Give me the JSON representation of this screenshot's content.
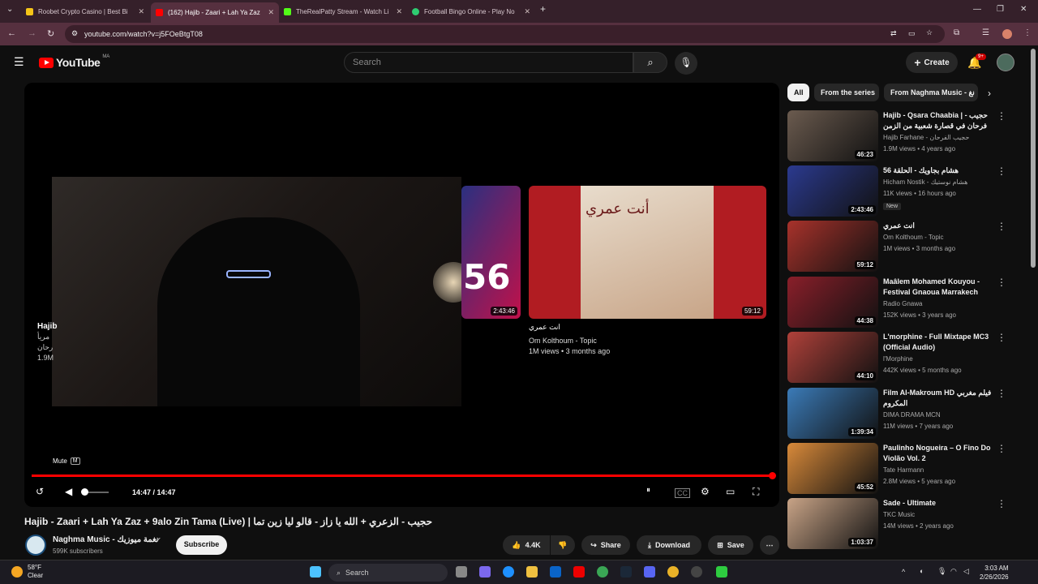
{
  "browser": {
    "tabs": [
      {
        "title": "Roobet Crypto Casino | Best Bi",
        "favicon_color": "#f5c518",
        "active": false
      },
      {
        "title": "(162) Hajib - Zaari + Lah Ya Zaz",
        "favicon_color": "#ff0000",
        "active": true
      },
      {
        "title": "TheRealPatty Stream - Watch Li",
        "favicon_color": "#53fc18",
        "active": false
      },
      {
        "title": "Football Bingo Online - Play No",
        "favicon_color": "#2ecc71",
        "active": false
      }
    ],
    "new_tab": "+",
    "url": "youtube.com/watch?v=j5FOeBtgT08"
  },
  "yt": {
    "logo_text": "YouTube",
    "country": "MA",
    "search_placeholder": "Search",
    "create_label": "Create",
    "notif_badge": "9+"
  },
  "player": {
    "mute_tooltip": "Mute",
    "mute_key": "M",
    "time": "14:47 / 14:47",
    "progress": 1.0,
    "left_card": {
      "title": "Hajib",
      "line2": "مريأ",
      "line3": "رحان",
      "views": "1.9M"
    },
    "endcard1": {
      "overlay": "56",
      "duration": "2:43:46"
    },
    "endcard2": {
      "poster_title": "أنت عمري",
      "duration": "59:12",
      "title": "انت عمري",
      "channel": "Om Kolthoum - Topic",
      "meta": "1M views • 3 months ago"
    }
  },
  "video": {
    "title": "Hajib - Zaari + Lah Ya Zaz + 9alo Zin Tama (Live) | حجيب - الزعري + الله يا زاز - قالو ليا زين تما",
    "channel": "Naghma Music - نغمة ميوزيك",
    "subscribers": "599K subscribers",
    "subscribe": "Subscribe",
    "likes": "4.4K",
    "share": "Share",
    "download": "Download",
    "save": "Save"
  },
  "sidebar": {
    "chips": [
      "All",
      "From the series",
      "From Naghma Music - نغ"
    ],
    "items": [
      {
        "title": "Hajib - Qsara Chaabia | حجيب - فرحان في قصارة شعبية من الزمن الجميل",
        "channel": "Hajib Farhane - حجيب الفرحان",
        "meta": "1.9M views • 4 years ago",
        "duration": "46:23",
        "color": "#6b5b4f",
        "badge": ""
      },
      {
        "title": "56 هشام بجاويك - الحلقة",
        "channel": "Hicham Nostik - هشام نوستيك",
        "meta": "11K views • 16 hours ago",
        "duration": "2:43:46",
        "color": "#2b3a8f",
        "badge": "New"
      },
      {
        "title": "انت عمري",
        "channel": "Om Kolthoum - Topic",
        "meta": "1M views • 3 months ago",
        "duration": "59:12",
        "color": "#a8322b",
        "badge": ""
      },
      {
        "title": "Maâlem Mohamed Kouyou - Festival Gnaoua Marrakech",
        "channel": "Radio Gnawa",
        "meta": "152K views • 3 years ago",
        "duration": "44:38",
        "color": "#8a1f2a",
        "badge": ""
      },
      {
        "title": "L'morphine - Full Mixtape MC3 (Official Audio)",
        "channel": "l'Morphine",
        "meta": "442K views • 5 months ago",
        "duration": "44:10",
        "color": "#b0413a",
        "badge": ""
      },
      {
        "title": "Film Al-Makroum HD فيلم مغربي المكروم",
        "channel": "DIMA DRAMA MCN",
        "meta": "11M views • 7 years ago",
        "duration": "1:39:34",
        "color": "#3b7bb8",
        "badge": ""
      },
      {
        "title": "Paulinho Nogueira – O Fino Do Violão Vol. 2",
        "channel": "Tate Harmann",
        "meta": "2.8M views • 5 years ago",
        "duration": "45:52",
        "color": "#d98a3a",
        "badge": ""
      },
      {
        "title": "Sade - Ultimate",
        "channel": "TKC Music",
        "meta": "14M views • 2 years ago",
        "duration": "1:03:37",
        "color": "#c9a487",
        "badge": ""
      }
    ]
  },
  "taskbar": {
    "temp": "58°F",
    "condition": "Clear",
    "search": "Search",
    "time": "3:03 AM",
    "date": "2/26/2026"
  }
}
